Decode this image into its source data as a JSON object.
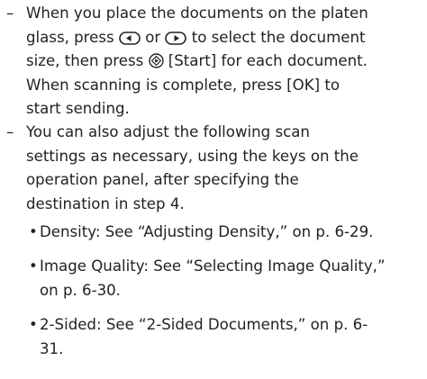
{
  "items": [
    {
      "marker": "–",
      "segments": {
        "l1": "When you place the documents on the platen",
        "l2a": "glass, press ",
        "l2b": " or ",
        "l2c": " to select the document",
        "l3a": "size, then press ",
        "l3b": " [Start] for each document.",
        "l4": "When scanning is complete, press [OK] to",
        "l5": "start sending."
      },
      "icons": [
        "left-arrow-key-icon",
        "right-arrow-key-icon",
        "start-key-icon"
      ]
    },
    {
      "marker": "–",
      "lines": [
        "You can also adjust the following scan",
        "settings as necessary, using the keys on the",
        "operation panel, after specifying the",
        "destination in step 4."
      ]
    }
  ],
  "sub_items": [
    {
      "marker": "•",
      "lines": [
        "Density: See “Adjusting Density,” on p. 6-29."
      ]
    },
    {
      "marker": "•",
      "lines": [
        "Image Quality: See “Selecting Image Quality,”",
        "on p. 6-30."
      ]
    },
    {
      "marker": "•",
      "lines": [
        "2-Sided: See “2-Sided Documents,” on p. 6-",
        "31."
      ]
    }
  ]
}
